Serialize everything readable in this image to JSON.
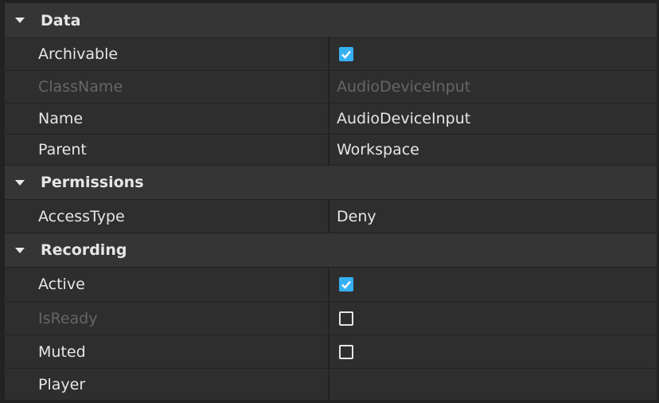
{
  "sections": [
    {
      "title": "Data",
      "rows": [
        {
          "name": "Archivable",
          "type": "checkbox",
          "checked": true,
          "disabled": false
        },
        {
          "name": "ClassName",
          "type": "text",
          "value": "AudioDeviceInput",
          "disabled": true
        },
        {
          "name": "Name",
          "type": "text",
          "value": "AudioDeviceInput",
          "disabled": false
        },
        {
          "name": "Parent",
          "type": "text",
          "value": "Workspace",
          "disabled": false
        }
      ]
    },
    {
      "title": "Permissions",
      "rows": [
        {
          "name": "AccessType",
          "type": "text",
          "value": "Deny",
          "disabled": false
        }
      ]
    },
    {
      "title": "Recording",
      "rows": [
        {
          "name": "Active",
          "type": "checkbox",
          "checked": true,
          "disabled": false
        },
        {
          "name": "IsReady",
          "type": "checkbox",
          "checked": false,
          "disabled": true
        },
        {
          "name": "Muted",
          "type": "checkbox",
          "checked": false,
          "disabled": false
        },
        {
          "name": "Player",
          "type": "text",
          "value": "",
          "disabled": false
        }
      ]
    }
  ],
  "colors": {
    "accent": "#35b1f2",
    "header_bg": "#353535",
    "row_bg": "#2e2e2e",
    "disabled_text": "#666666"
  }
}
